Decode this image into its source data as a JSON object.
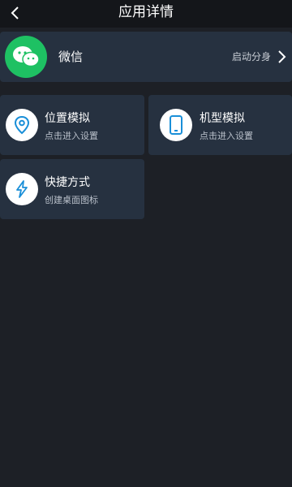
{
  "header": {
    "title": "应用详情",
    "back_icon": "chevron-left-icon"
  },
  "app": {
    "name": "微信",
    "action_label": "启动分身",
    "icon": "wechat-icon",
    "icon_color": "#1ec163"
  },
  "features": [
    {
      "title": "位置模拟",
      "subtitle": "点击进入设置",
      "icon": "location-pin-icon"
    },
    {
      "title": "机型模拟",
      "subtitle": "点击进入设置",
      "icon": "phone-icon"
    },
    {
      "title": "快捷方式",
      "subtitle": "创建桌面图标",
      "icon": "lightning-icon"
    }
  ],
  "colors": {
    "background": "#1d2026",
    "card": "#263140",
    "accent": "#1a8fd8"
  }
}
